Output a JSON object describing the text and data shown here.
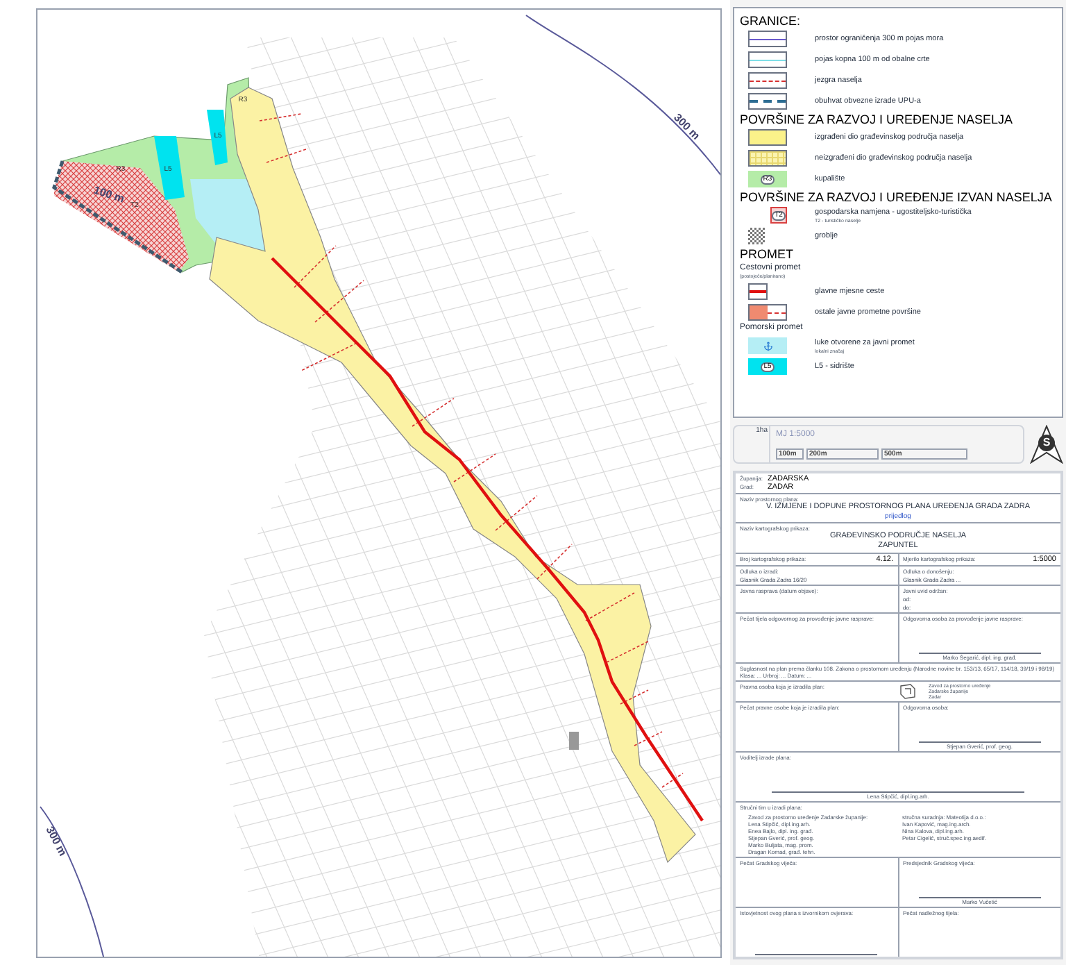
{
  "map": {
    "labels": [
      {
        "text": "300 m"
      },
      {
        "text": "300 m"
      },
      {
        "text": "100 m"
      }
    ],
    "zone_symbols": [
      "R3",
      "L5",
      "R3",
      "L5",
      "T2"
    ]
  },
  "legend": {
    "sections": [
      {
        "title": "GRANICE:",
        "groups": [
          {
            "items": [
              {
                "kind": "coastline",
                "label": "prostor ograničenja 300 m pojas mora"
              },
              {
                "kind": "landstrip",
                "label": "pojas kopna 100 m od obalne crte"
              },
              {
                "kind": "core",
                "label": "jezgra naselja"
              },
              {
                "kind": "upu",
                "label": "obuhvat obvezne izrade UPU-a"
              }
            ]
          }
        ]
      },
      {
        "title": "POVRŠINE ZA RAZVOJ I UREĐENJE NASELJA",
        "groups": [
          {
            "items": [
              {
                "kind": "built",
                "label": "izgrađeni dio građevinskog područja naselja"
              },
              {
                "kind": "unbuilt",
                "label": "neizgrađeni dio građevinskog područja naselja"
              },
              {
                "kind": "beach",
                "label": "kupalište",
                "symbol": "R3"
              }
            ]
          }
        ]
      },
      {
        "title": "POVRŠINE ZA RAZVOJ I UREĐENJE IZVAN NASELJA",
        "groups": [
          {
            "items": [
              {
                "kind": "tourism",
                "label": "gospodarska namjena - ugostiteljsko-turistička",
                "note": "T2 - turističko naselje",
                "symbol": "T2"
              },
              {
                "kind": "cemetery",
                "label": "groblje"
              }
            ]
          }
        ]
      },
      {
        "title": "PROMET",
        "groups": [
          {
            "title": "Cestovni promet",
            "note": "(postojeće/planirano)",
            "items": [
              {
                "kind": "mainroad",
                "label": "glavne mjesne ceste"
              },
              {
                "kind": "otherroad",
                "label": "ostale javne prometne površine"
              }
            ]
          },
          {
            "title": "Pomorski promet",
            "items": [
              {
                "kind": "harbor",
                "label": "luke otvorene za javni promet",
                "note": "lokalni značaj"
              },
              {
                "kind": "anchorage",
                "label": "L5 - sidrište",
                "symbol": "L5"
              }
            ]
          }
        ]
      }
    ]
  },
  "scale": {
    "area_label": "1ha",
    "ratio": "MJ 1:5000",
    "ticks": [
      "100m",
      "200m",
      "500m"
    ],
    "north": "S"
  },
  "title_block": {
    "rows": [
      {
        "cells": [
          {
            "kind": "pairs",
            "pairs": [
              {
                "label": "Županija:",
                "value": "ZADARSKA"
              },
              {
                "label": "Grad:",
                "value": "ZADAR"
              }
            ]
          }
        ]
      },
      {
        "cells": [
          {
            "kind": "title",
            "label": "Naziv prostornog plana:",
            "lines": [
              "V. IZMJENE I DOPUNE PROSTORNOG PLANA UREĐENJA GRADA ZADRA"
            ],
            "accent": "prijedlog"
          }
        ]
      },
      {
        "cells": [
          {
            "kind": "title",
            "label": "Naziv kartografskog prikaza:",
            "lines": [
              "GRAĐEVINSKO PODRUČJE NASELJA",
              "ZAPUNTEL"
            ]
          }
        ]
      },
      {
        "cells": [
          {
            "kind": "field",
            "label": "Broj kartografskog prikaza:",
            "value": "4.12."
          },
          {
            "kind": "field",
            "label": "Mjerilo kartografskog prikaza:",
            "value": "1:5000"
          }
        ]
      },
      {
        "cells": [
          {
            "kind": "field",
            "label": "Odluka o izradi:",
            "lines": [
              "Glasnik Grada Zadra 16/20"
            ]
          },
          {
            "kind": "field",
            "label": "Odluka o donošenju:",
            "lines": [
              "Glasnik Grada Zadra ..."
            ]
          }
        ]
      },
      {
        "cells": [
          {
            "kind": "field",
            "label": "Javna rasprava (datum objave):"
          },
          {
            "kind": "field",
            "label": "Javni uvid održan:",
            "lines": [
              "od:",
              "do:"
            ]
          }
        ]
      },
      {
        "cells": [
          {
            "kind": "signature",
            "label": "Pečat tijela odgovornog za provođenje javne rasprave:"
          },
          {
            "kind": "signature",
            "label": "Odgovorna osoba za provođenje javne rasprave:",
            "signature": "Marko Šegarić, dipl. ing. građ.",
            "line": true
          }
        ]
      },
      {
        "cells": [
          {
            "kind": "note",
            "lines": [
              "Suglasnost na plan prema članku 108. Zakona o prostornom uređenju (Narodne novine br. 153/13, 65/17, 114/18, 39/19 i 98/19)",
              "Klasa: ...   Urbroj: ...   Datum: ..."
            ]
          }
        ]
      },
      {
        "cells": [
          {
            "kind": "firm",
            "label": "Pravna osoba koja je izradila plan:",
            "lines": [
              "Zavod za prostorno uređenje",
              "Zadarske županije",
              "Zadar"
            ]
          }
        ]
      },
      {
        "cells": [
          {
            "kind": "signature",
            "label": "Pečat pravne osobe koja je izradila plan:"
          },
          {
            "kind": "signature",
            "label": "Odgovorna osoba:",
            "signature": "Stjepan Gverić, prof. geog.",
            "line": true
          }
        ]
      },
      {
        "cells": [
          {
            "kind": "signature",
            "label": "Voditelj izrade plana:",
            "signature": "Lena Stipčić, dipl.ing.arh.",
            "line": true
          }
        ]
      },
      {
        "cells": [
          {
            "kind": "team",
            "label": "Stručni tim u izradi plana:",
            "columns": [
              {
                "heading": "Zavod za prostorno uređenje Zadarske županije:",
                "members": [
                  "Lena Stipčić, dipl.ing.arh.",
                  "Enea Bajlo, dipl. ing. građ.",
                  "Stjepan Gverić, prof. geog.",
                  "Marko Buljata, mag. prom.",
                  "Dragan Komad, građ. tehn."
                ]
              },
              {
                "heading": "stručna suradnja: Mateotija d.o.o.:",
                "members": [
                  "Ivan Kapović, mag.ing.arch.",
                  "Nina Kalova, dipl.ing.arh.",
                  "Petar Cigelić, struč.spec.ing.aedif."
                ]
              }
            ]
          }
        ]
      },
      {
        "cells": [
          {
            "kind": "signature",
            "label": "Pečat Gradskog vijeća:"
          },
          {
            "kind": "signature",
            "label": "Predsjednik Gradskog vijeća:",
            "signature": "Marko Vučetić",
            "line": true
          }
        ]
      },
      {
        "cells": [
          {
            "kind": "signature",
            "label": "Istovjetnost ovog plana s izvornikom ovjerava:",
            "line": true
          },
          {
            "kind": "signature",
            "label": "Pečat nadležnog tijela:"
          }
        ]
      }
    ]
  }
}
